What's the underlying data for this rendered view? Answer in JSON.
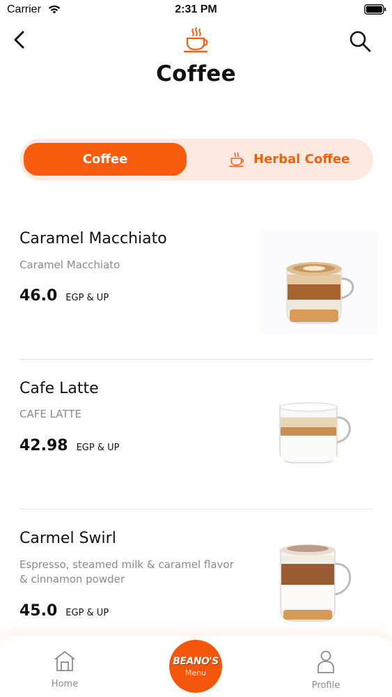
{
  "status_bar": {
    "carrier": "Carrier",
    "time": "2:31 PM"
  },
  "header": {
    "title": "Coffee"
  },
  "tabs": [
    {
      "label": "Coffee",
      "active": true
    },
    {
      "label": "Herbal Coffee",
      "active": false
    }
  ],
  "products": [
    {
      "name": "Caramel Macchiato",
      "description": "Caramel Macchiato",
      "price": "46.0",
      "unit": "EGP & UP"
    },
    {
      "name": "Cafe Latte",
      "description": "CAFE LATTE",
      "price": "42.98",
      "unit": "EGP & UP"
    },
    {
      "name": "Carmel Swirl",
      "description": "Espresso, steamed milk & caramel flavor & cinnamon powder",
      "price": "45.0",
      "unit": "EGP & UP"
    }
  ],
  "bottom_nav": {
    "home_label": "Home",
    "logo_text": "BEANO'S",
    "menu_label": "Menu",
    "profile_label": "Profile"
  },
  "colors": {
    "accent": "#f95c0e",
    "tab_bg": "#fde9e0",
    "muted_text": "#8a8a8a"
  },
  "icons": [
    "wifi-icon",
    "battery-icon",
    "back-chevron-icon",
    "coffee-cup-icon",
    "search-icon",
    "home-icon",
    "profile-icon"
  ]
}
